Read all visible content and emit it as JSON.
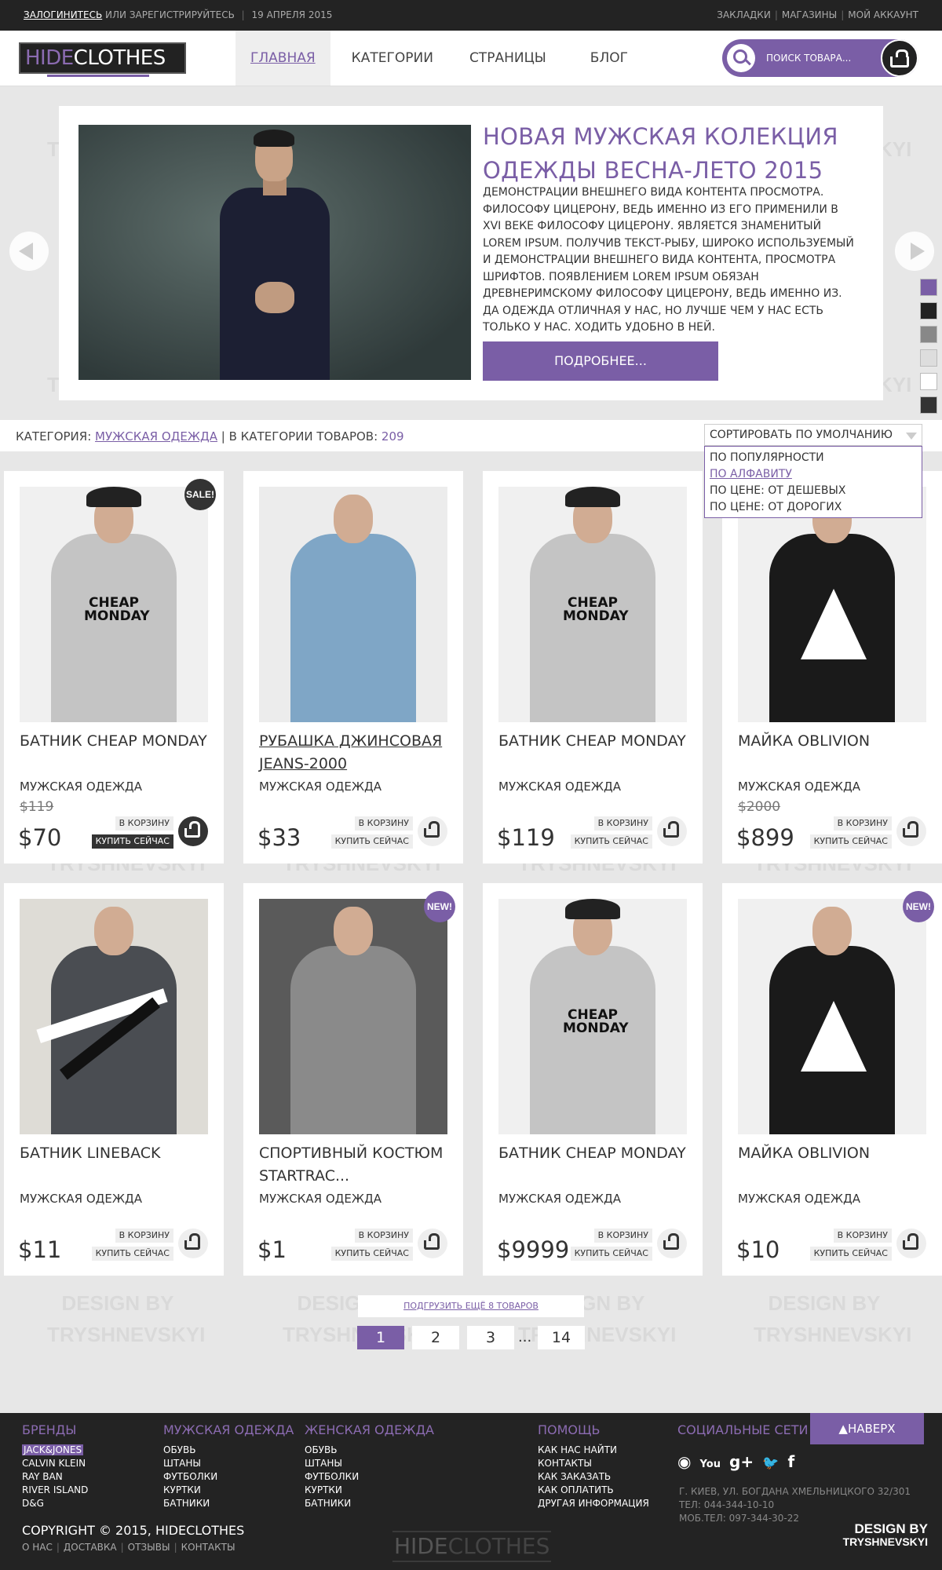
{
  "topbar": {
    "login": "ЗАЛОГИНИТЕСЬ",
    "or_register": "ИЛИ ЗАРЕГИСТРИРУЙТЕСЬ",
    "date": "19 АПРЕЛЯ 2015",
    "links": [
      "ЗАКЛАДКИ",
      "МАГАЗИНЫ",
      "МОЙ АККАУНТ"
    ]
  },
  "brand": {
    "part1": "HIDE",
    "part2": "CLOTHES"
  },
  "nav": [
    "ГЛАВНАЯ",
    "КАТЕГОРИИ",
    "СТРАНИЦЫ",
    "БЛОГ"
  ],
  "search": {
    "placeholder": "ПОИСК ТОВАРА..."
  },
  "watermark": {
    "line1": "DESIGN BY",
    "line2": "TRYSHNEVSKYI"
  },
  "slider": {
    "title": "НОВАЯ МУЖСКАЯ КОЛЕКЦИЯ ОДЕЖДЫ ВЕСНА-ЛЕТО 2015",
    "text": "ДЕМОНСТРАЦИИ ВНЕШНЕГО ВИДА КОНТЕНТА ПРОСМОТРА. ФИЛОСОФУ ЦИЦЕРОНУ, ВЕДЬ ИМЕННО ИЗ ЕГО ПРИМЕНИЛИ В XVI ВЕКЕ ФИЛОСОФУ ЦИЦЕРОНУ. ЯВЛЯЕТСЯ ЗНАМЕНИТЫЙ LOREM IPSUM. ПОЛУЧИВ ТЕКСТ-РЫБУ, ШИРОКО ИСПОЛЬЗУЕМЫЙ И ДЕМОНСТРАЦИИ ВНЕШНЕГО ВИДА КОНТЕНТА, ПРОСМОТРА ШРИФТОВ. ПОЯВЛЕНИЕМ LOREM IPSUM ОБЯЗАН ДРЕВНЕРИМСКОМУ ФИЛОСОФУ ЦИЦЕРОНУ, ВЕДЬ ИМЕННО ИЗ. ДА ОДЕЖДА ОТЛИЧНАЯ У НАС, НО ЛУЧШЕ ЧЕМ У НАС ЕСТЬ ТОЛЬКО У НАС. ХОДИТЬ УДОБНО В НЕЙ.",
    "button": "ПОДРОБНЕЕ..."
  },
  "swatches": [
    "#7a5ea6",
    "#222222",
    "#888888",
    "#dddddd",
    "#ffffff",
    "#333333"
  ],
  "category_bar": {
    "label": "КАТЕГОРИЯ:",
    "category": "МУЖСКАЯ ОДЕЖДА",
    "count_label": "| В КАТЕГОРИИ ТОВАРОВ:",
    "count": "209"
  },
  "sort": {
    "selected": "СОРТИРОВАТЬ ПО УМОЛЧАНИЮ",
    "options": [
      "ПО ПОПУЛЯРНОСТИ",
      "ПО АЛФАВИТУ",
      "ПО ЦЕНЕ: ОТ ДЕШЕВЫХ",
      "ПО ЦЕНЕ: ОТ ДОРОГИХ"
    ]
  },
  "product_labels": {
    "to_cart": "В КОРЗИНУ",
    "buy_now": "КУПИТЬ СЕЙЧАС"
  },
  "products": [
    {
      "name": "БАТНИК CHEAP MONDAY",
      "category": "МУЖСКАЯ ОДЕЖДА",
      "old_price": "$119",
      "price": "$70",
      "badge": "SALE!"
    },
    {
      "name": "РУБАШКА ДЖИНСОВАЯ JEANS-2000",
      "category": "МУЖСКАЯ ОДЕЖДА",
      "old_price": "",
      "price": "$33",
      "badge": ""
    },
    {
      "name": "БАТНИК CHEAP MONDAY",
      "category": "МУЖСКАЯ ОДЕЖДА",
      "old_price": "",
      "price": "$119",
      "badge": ""
    },
    {
      "name": "МАЙКА OBLIVION",
      "category": "МУЖСКАЯ ОДЕЖДА",
      "old_price": "$2000",
      "price": "$899",
      "badge": ""
    },
    {
      "name": "БАТНИК LINEBACK",
      "category": "МУЖСКАЯ ОДЕЖДА",
      "old_price": "",
      "price": "$11",
      "badge": ""
    },
    {
      "name": "СПОРТИВНЫЙ КОСТЮМ STARTRAC...",
      "category": "МУЖСКАЯ ОДЕЖДА",
      "old_price": "",
      "price": "$1",
      "badge": "NEW!"
    },
    {
      "name": "БАТНИК CHEAP MONDAY",
      "category": "МУЖСКАЯ ОДЕЖДА",
      "old_price": "",
      "price": "$9999",
      "badge": ""
    },
    {
      "name": "МАЙКА OBLIVION",
      "category": "МУЖСКАЯ ОДЕЖДА",
      "old_price": "",
      "price": "$10",
      "badge": "NEW!"
    }
  ],
  "load_more": "ПОДГРУЗИТЬ ЕЩЁ 8 ТОВАРОВ",
  "pagination": {
    "pages": [
      "1",
      "2",
      "3"
    ],
    "ellipsis": "...",
    "last": "14"
  },
  "footer": {
    "brands": {
      "title": "БРЕНДЫ",
      "items": [
        "JACK&JONES",
        "CALVIN KLEIN",
        "RAY BAN",
        "RIVER ISLAND",
        "D&G"
      ]
    },
    "men": {
      "title": "МУЖСКАЯ ОДЕЖДА",
      "items": [
        "ОБУВЬ",
        "ШТАНЫ",
        "ФУТБОЛКИ",
        "КУРТКИ",
        "БАТНИКИ"
      ]
    },
    "women": {
      "title": "ЖЕНСКАЯ ОДЕЖДА",
      "items": [
        "ОБУВЬ",
        "ШТАНЫ",
        "ФУТБОЛКИ",
        "КУРТКИ",
        "БАТНИКИ"
      ]
    },
    "help": {
      "title": "ПОМОЩЬ",
      "items": [
        "КАК НАС НАЙТИ",
        "КОНТАКТЫ",
        "КАК ЗАКАЗАТЬ",
        "КАК ОПЛАТИТЬ",
        "ДРУГАЯ ИНФОРМАЦИЯ"
      ]
    },
    "social": {
      "title": "СОЦИАЛЬНЫЕ СЕТИ",
      "icons": [
        "rss-icon",
        "youtube-icon",
        "google-plus-icon",
        "twitter-icon",
        "facebook-icon"
      ],
      "glyphs": [
        "◉",
        "You",
        "g+",
        "🐦",
        "f"
      ]
    },
    "address": [
      "Г. КИЕВ, УЛ. БОГДАНА ХМЕЛЬНИЦКОГО 32/301",
      "ТЕЛ: 044-344-10-10",
      "МОБ.ТЕЛ: 097-344-30-22"
    ],
    "to_top": "▲НАВЕРХ",
    "copyright": "COPYRIGHT © 2015, HIDECLOTHES",
    "links": [
      "О НАС",
      "ДОСТАВКА",
      "ОТЗЫВЫ",
      "КОНТАКТЫ"
    ],
    "design_by": "DESIGN BY",
    "designer": "TRYSHNEVSKYI"
  }
}
